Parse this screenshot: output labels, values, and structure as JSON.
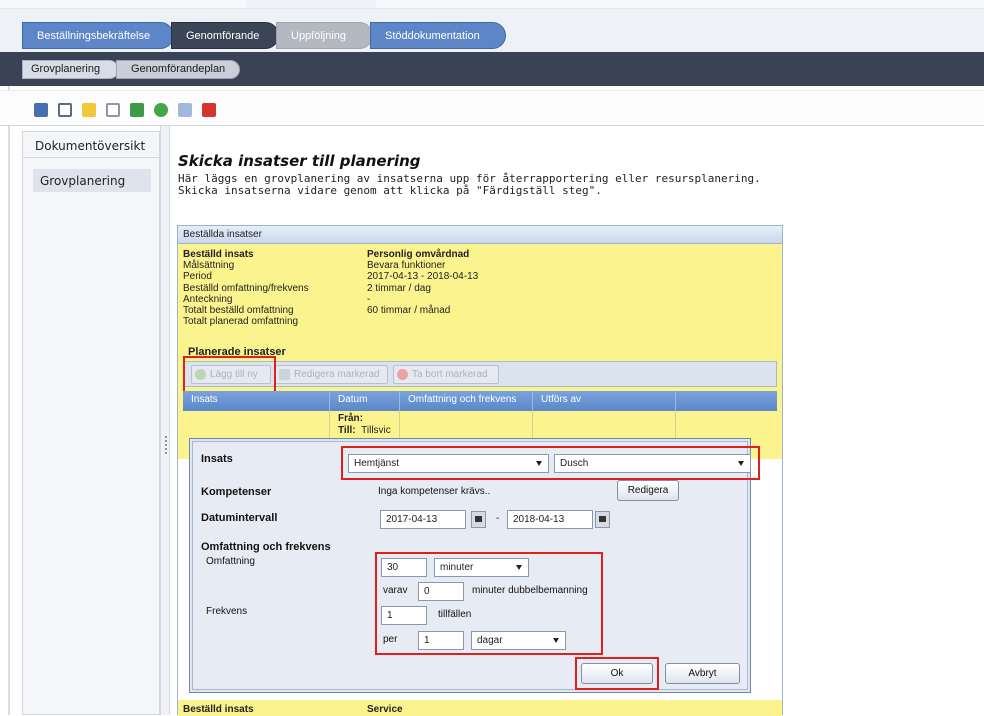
{
  "main_tabs": [
    {
      "label": "Beställningsbekräftelse"
    },
    {
      "label": "Genomförande"
    },
    {
      "label": "Uppföljning"
    },
    {
      "label": "Stöddokumentation"
    }
  ],
  "sub_tabs": [
    {
      "label": "Grovplanering"
    },
    {
      "label": "Genomförandeplan"
    }
  ],
  "toolbar_icons": [
    "save-icon",
    "document-icon",
    "folder-icon",
    "mail-icon",
    "refresh-icon",
    "check-icon",
    "spellcheck-icon",
    "calendar-icon"
  ],
  "sidebar": {
    "header": "Dokumentöversikt",
    "items": [
      {
        "label": "Grovplanering"
      }
    ]
  },
  "page": {
    "title": "Skicka insatser till planering",
    "desc_line1": "Här läggs en grovplanering av insatserna upp för återrapportering eller resursplanering.",
    "desc_line2": "Skicka insatserna vidare genom att klicka på \"Färdigställ steg\"."
  },
  "panel": {
    "header": "Beställda insatser",
    "details": [
      {
        "label": "Beställd insats",
        "value": "Personlig omvårdnad"
      },
      {
        "label": "Målsättning",
        "value": "Bevara funktioner"
      },
      {
        "label": "Period",
        "value": "2017-04-13  -  2018-04-13"
      },
      {
        "label": "Beställd omfattning/frekvens",
        "value": "2 timmar / dag"
      },
      {
        "label": "Anteckning",
        "value": "-"
      },
      {
        "label": "Totalt beställd omfattning",
        "value": "60 timmar / månad"
      },
      {
        "label": "Totalt planerad omfattning",
        "value": ""
      }
    ],
    "planned_header": "Planerade insatser",
    "buttons": {
      "add": "Lägg till ny",
      "edit": "Redigera markerad",
      "remove": "Ta bort markerad"
    },
    "columns": [
      "Insats",
      "Datum",
      "Omfattning och frekvens",
      "Utförs av"
    ],
    "row": {
      "from_label": "Från:",
      "to_label": "Till:",
      "to_value": "Tillsvic"
    },
    "next_label": "Beställd insats",
    "next_value": "Service"
  },
  "editor": {
    "insats_label": "Insats",
    "insats_select": "Hemtjänst",
    "insats_sub_select": "Dusch",
    "kompetenser_label": "Kompetenser",
    "kompetenser_value": "Inga kompetenser krävs..",
    "redigera_button": "Redigera",
    "datum_label": "Datumintervall",
    "date_from": "2017-04-13",
    "date_sep": "-",
    "date_to": "2018-04-13",
    "omf_header": "Omfattning och frekvens",
    "omfattning_label": "Omfattning",
    "omfattning_value": "30",
    "omfattning_unit": "minuter",
    "varav_label": "varav",
    "varav_value": "0",
    "dubbel_label": "minuter dubbelbemanning",
    "frekvens_label": "Frekvens",
    "frekvens_value": "1",
    "tillfallen_label": "tillfällen",
    "per_label": "per",
    "per_value": "1",
    "per_unit": "dagar",
    "ok_button": "Ok",
    "cancel_button": "Avbryt"
  },
  "colors": {
    "highlight_box": "#e0201f",
    "yellow_bg": "#fbf38e",
    "tab_blue": "#5c86c7",
    "dark_bar": "#3a4256"
  }
}
